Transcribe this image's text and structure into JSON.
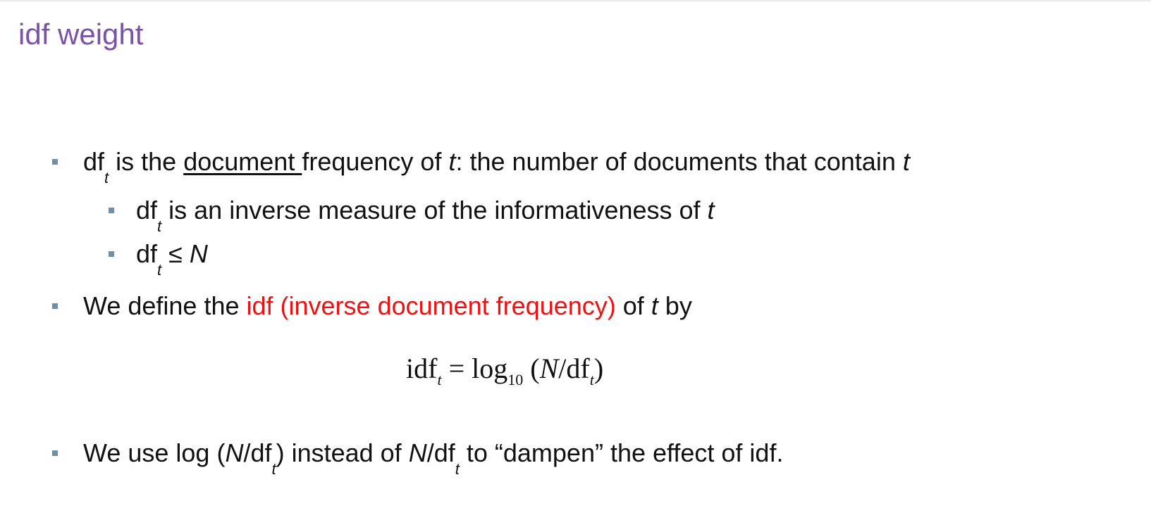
{
  "slide": {
    "title": "idf weight",
    "colors": {
      "title": "#7a52a8",
      "highlight": "#ee1111",
      "bullet": "#6f8fa9"
    },
    "bullet1": {
      "df": "df",
      "sub": "t",
      "a": " is the ",
      "underlined": "document ",
      "b": "frequency of ",
      "t1": "t",
      "c": ": the number of documents that contain ",
      "t2": "t"
    },
    "sub1": {
      "df": "df",
      "sub": "t",
      "a": " is an inverse measure of the informativeness of ",
      "t": "t"
    },
    "sub2": {
      "df": "df",
      "sub": "t",
      "a": " ≤ ",
      "n": "N"
    },
    "bullet2": {
      "a": "We define the ",
      "red": "idf (inverse document frequency)",
      "b": " of ",
      "t": "t",
      "c": " by"
    },
    "formula": {
      "lhs": "idf",
      "lhs_sub": "t",
      "eq": " = log",
      "log_base": "10",
      "open": " (",
      "n": "N",
      "slash": "/df",
      "rhs_sub": "t",
      "close": ")"
    },
    "bullet3": {
      "a": "We use log (",
      "n1": "N",
      "b": "/df",
      "sub1": "t",
      "c": ") instead of ",
      "n2": "N",
      "d": "/df",
      "sub2": "t",
      "e": " to “dampen” the effect of idf."
    }
  }
}
